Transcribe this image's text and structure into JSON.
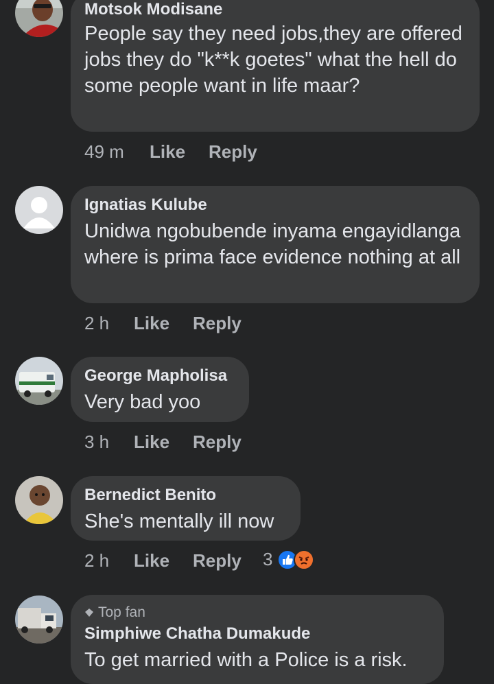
{
  "comments": [
    {
      "author": "Motsok Modisane",
      "text": "People say they need jobs,they are offered jobs they do \"k**k goetes\" what the hell do some people want in life maar?",
      "time": "49 m",
      "like": "Like",
      "reply": "Reply",
      "avatar": "person-photo"
    },
    {
      "author": "Ignatias Kulube",
      "text": "Unidwa ngobubende inyama engayidlanga where is prima face evidence nothing at all",
      "time": "2 h",
      "like": "Like",
      "reply": "Reply",
      "avatar": "default-profile"
    },
    {
      "author": "George Mapholisa",
      "text": "Very bad yoo",
      "time": "3 h",
      "like": "Like",
      "reply": "Reply",
      "avatar": "police-van-photo"
    },
    {
      "author": "Bernedict Benito",
      "text": "She's mentally ill now",
      "time": "2 h",
      "like": "Like",
      "reply": "Reply",
      "reaction_count": "3",
      "reactions": [
        "like-reaction-icon",
        "angry-reaction-icon"
      ],
      "avatar": "baby-photo"
    },
    {
      "badge": "Top fan",
      "author": "Simphiwe Chatha Dumakude",
      "text": "To get married with a Police is a risk.",
      "avatar": "truck-photo"
    }
  ],
  "colors": {
    "background": "#242526",
    "bubble": "#3a3b3c",
    "text": "#e4e6eb",
    "secondary": "#b0b3b8",
    "like_blue": "#1877f2",
    "angry_orange": "#f0702d"
  }
}
